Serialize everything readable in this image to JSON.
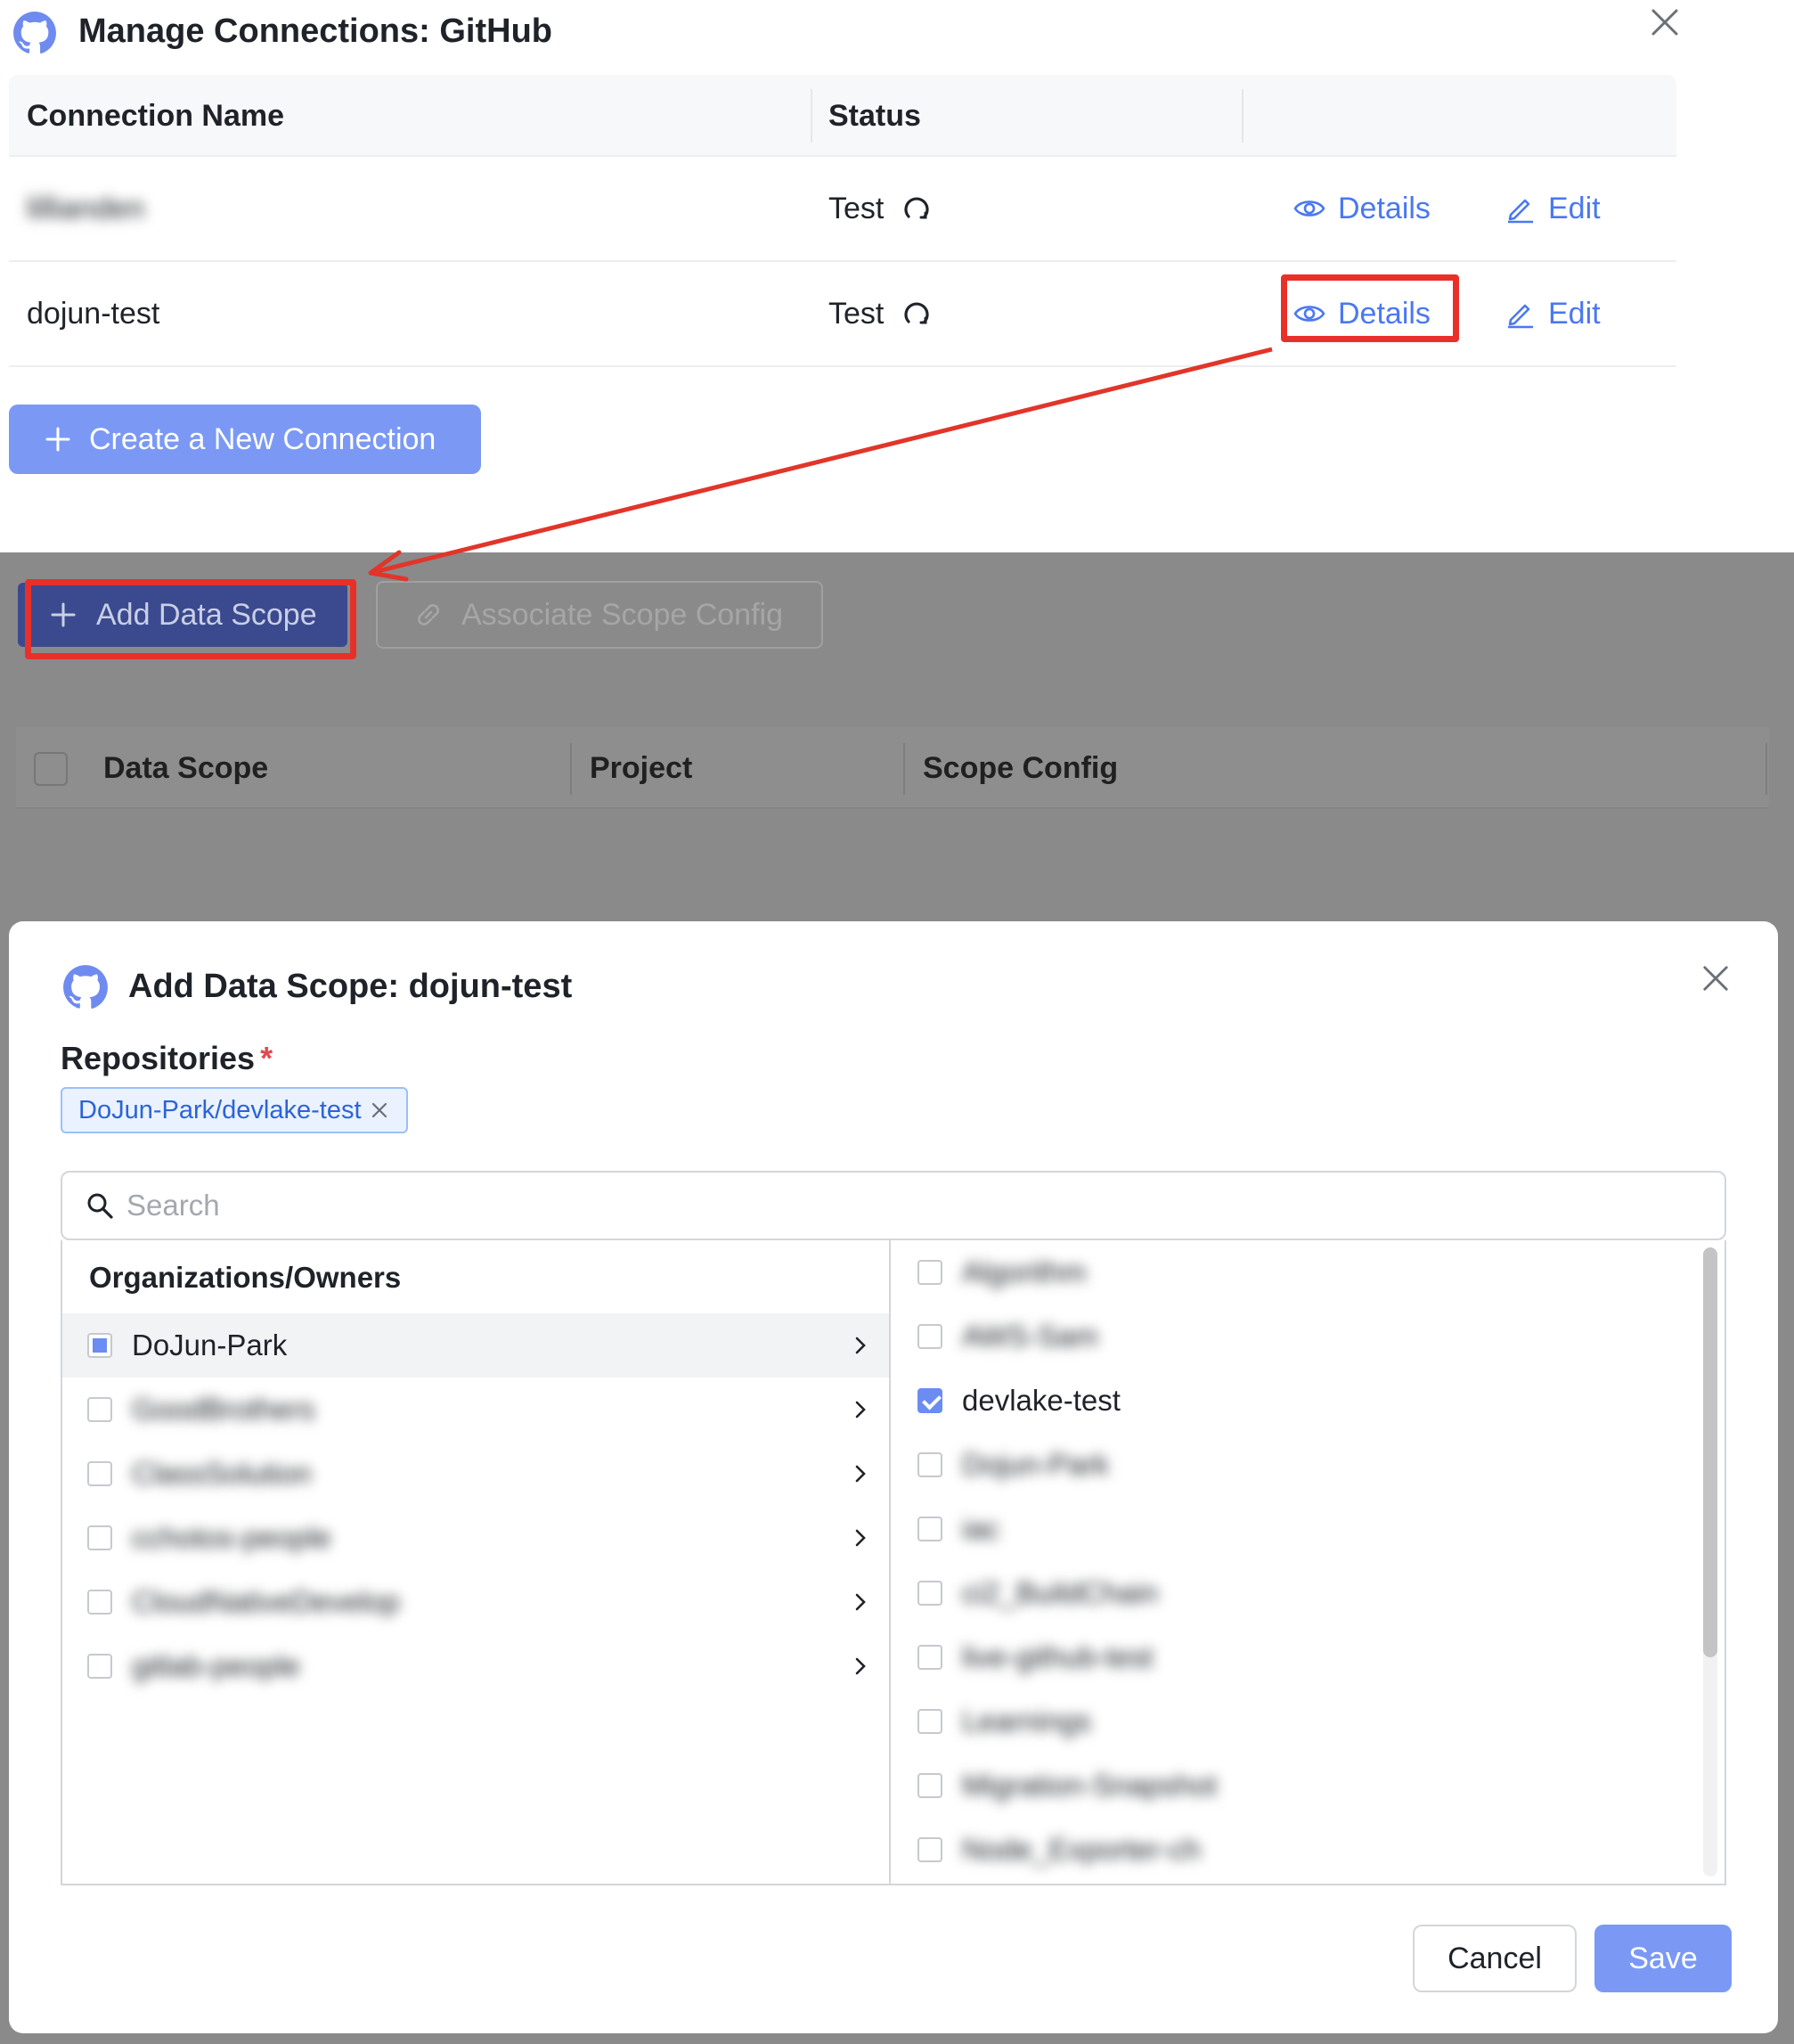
{
  "manage_dialog": {
    "title": "Manage Connections: GitHub",
    "icons": {
      "logo": "github-icon",
      "close": "close-icon"
    },
    "columns": [
      "Connection Name",
      "Status"
    ],
    "rows": [
      {
        "name": "lillianden",
        "status": "Test",
        "details": "Details",
        "edit": "Edit"
      },
      {
        "name": "dojun-test",
        "status": "Test",
        "details": "Details",
        "edit": "Edit"
      }
    ],
    "create_button": "Create a New Connection",
    "accent_color": "#4a78f0",
    "highlight_color": "#e8302a"
  },
  "scope_page": {
    "add_data_scope": "Add Data Scope",
    "associate_scope_config": "Associate Scope Config",
    "columns": [
      "Data Scope",
      "Project",
      "Scope Config"
    ]
  },
  "add_scope_modal": {
    "title": "Add Data Scope: dojun-test",
    "repositories_label": "Repositories",
    "required_mark": "*",
    "selected_tag": "DoJun-Park/devlake-test",
    "search_placeholder": "Search",
    "orgs_title": "Organizations/Owners",
    "orgs": [
      {
        "name": "DoJun-Park",
        "state": "partial"
      },
      {
        "name": "GoodBrothers",
        "state": "unchecked"
      },
      {
        "name": "ClassSolution",
        "state": "unchecked"
      },
      {
        "name": "cchotos-people",
        "state": "unchecked"
      },
      {
        "name": "CloudNativeDevelop",
        "state": "unchecked"
      },
      {
        "name": "gitlab-people",
        "state": "unchecked"
      }
    ],
    "repos": [
      {
        "name": "Algorithm",
        "checked": false
      },
      {
        "name": "AWS-Sam",
        "checked": false
      },
      {
        "name": "devlake-test",
        "checked": true
      },
      {
        "name": "Dojun-Park",
        "checked": false
      },
      {
        "name": "iac",
        "checked": false
      },
      {
        "name": "ci2_BuildChain",
        "checked": false
      },
      {
        "name": "live-github-test",
        "checked": false
      },
      {
        "name": "Learnings",
        "checked": false
      },
      {
        "name": "Migration-Snapshot",
        "checked": false
      },
      {
        "name": "Node_Exporter-ch",
        "checked": false
      }
    ],
    "cancel": "Cancel",
    "save": "Save",
    "accent_color": "#7b99f4"
  }
}
